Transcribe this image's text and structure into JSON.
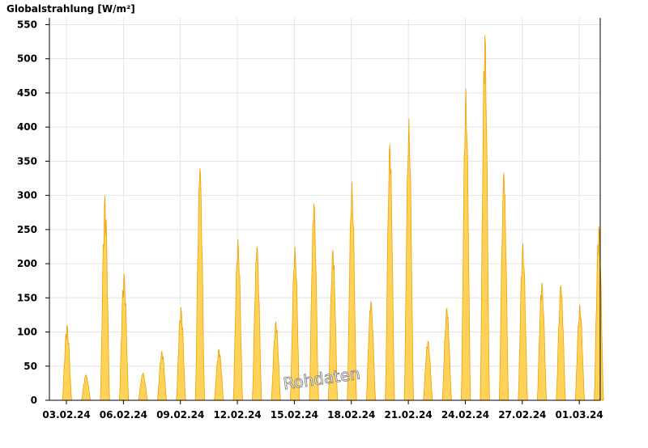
{
  "chart_data": {
    "type": "area",
    "ylabel": "Globalstrahlung [W/m²]",
    "ylim": [
      0,
      560
    ],
    "y_ticks": [
      0,
      50,
      100,
      150,
      200,
      250,
      300,
      350,
      400,
      450,
      500,
      550
    ],
    "x_tick_labels": [
      "03.02.24",
      "06.02.24",
      "09.02.24",
      "12.02.24",
      "15.02.24",
      "18.02.24",
      "21.02.24",
      "24.02.24",
      "27.02.24",
      "01.03.24"
    ],
    "grid": true,
    "watermark": "Rohdaten",
    "colors": {
      "fill": "#ffd35a",
      "line": "#f0a000",
      "grid": "#e4e4e4",
      "axis": "#000000"
    },
    "series": [
      {
        "x_start": "03.02.24",
        "x_end": "01.03.24",
        "days": [
          {
            "date": "03.02.24",
            "peak": 110
          },
          {
            "date": "04.02.24",
            "peak": 37
          },
          {
            "date": "05.02.24",
            "peak": 300
          },
          {
            "date": "06.02.24",
            "peak": 185
          },
          {
            "date": "07.02.24",
            "peak": 40
          },
          {
            "date": "08.02.24",
            "peak": 72
          },
          {
            "date": "09.02.24",
            "peak": 136
          },
          {
            "date": "10.02.24",
            "peak": 340
          },
          {
            "date": "11.02.24",
            "peak": 75
          },
          {
            "date": "12.02.24",
            "peak": 236
          },
          {
            "date": "13.02.24",
            "peak": 225
          },
          {
            "date": "14.02.24",
            "peak": 115
          },
          {
            "date": "15.02.24",
            "peak": 225
          },
          {
            "date": "16.02.24",
            "peak": 288
          },
          {
            "date": "17.02.24",
            "peak": 220
          },
          {
            "date": "18.02.24",
            "peak": 320
          },
          {
            "date": "19.02.24",
            "peak": 145
          },
          {
            "date": "20.02.24",
            "peak": 375
          },
          {
            "date": "21.02.24",
            "peak": 412
          },
          {
            "date": "22.02.24",
            "peak": 87
          },
          {
            "date": "23.02.24",
            "peak": 135
          },
          {
            "date": "24.02.24",
            "peak": 456
          },
          {
            "date": "25.02.24",
            "peak": 535
          },
          {
            "date": "26.02.24",
            "peak": 333
          },
          {
            "date": "27.02.24",
            "peak": 230
          },
          {
            "date": "28.02.24",
            "peak": 172
          },
          {
            "date": "29.02.24",
            "peak": 168
          },
          {
            "date": "01.03.24",
            "peak": 140
          },
          {
            "date": "02.03.24",
            "peak": 255
          }
        ]
      }
    ]
  }
}
